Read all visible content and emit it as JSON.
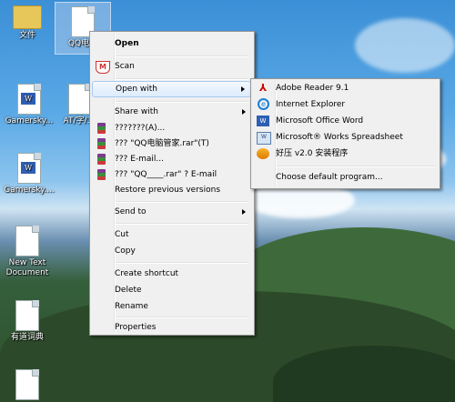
{
  "desktop_icons": {
    "folder": "文件",
    "qq": "QQ电脑",
    "gamersky1": "Gamersky...",
    "at": "AT/字/1F",
    "gamersky2": "Gamersky....",
    "newtext": "New Text Document",
    "youdao": "有道词典"
  },
  "context_menu": {
    "open": "Open",
    "scan": "Scan",
    "open_with": "Open with",
    "share_with": "Share with",
    "rar_add": "???????(A)...",
    "rar_add_named": "??? \"QQ电脑管家.rar\"(T)",
    "rar_email": "??? E-mail...",
    "rar_email_named": "??? \"QQ____.rar\" ? E-mail",
    "restore": "Restore previous versions",
    "send_to": "Send to",
    "cut": "Cut",
    "copy": "Copy",
    "create_shortcut": "Create shortcut",
    "delete": "Delete",
    "rename": "Rename",
    "properties": "Properties"
  },
  "open_with_menu": {
    "adobe": "Adobe Reader 9.1",
    "ie": "Internet Explorer",
    "word": "Microsoft Office Word",
    "works": "Microsoft® Works Spreadsheet",
    "haozip": "好压 v2.0 安装程序",
    "choose": "Choose default program..."
  },
  "icons": {
    "scan": "shield-icon",
    "rar": "winrar-icon",
    "adobe": "pdf-icon",
    "ie": "internet-explorer-icon",
    "word": "word-icon",
    "works": "spreadsheet-icon",
    "haozip": "haozip-icon"
  }
}
